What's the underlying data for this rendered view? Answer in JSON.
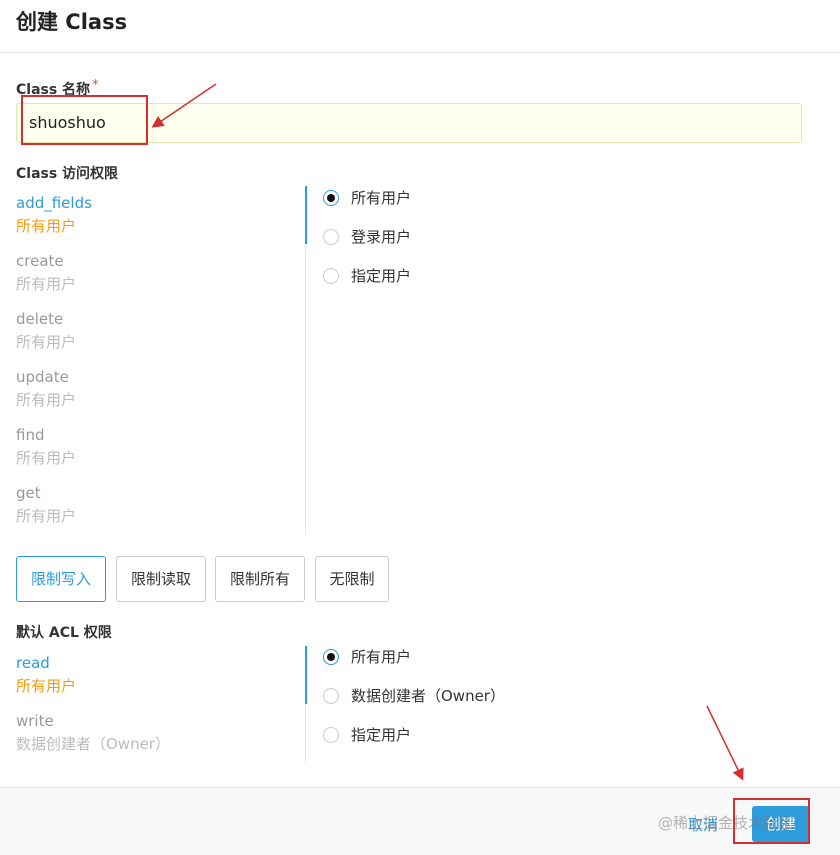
{
  "dialog": {
    "title": "创建 Class"
  },
  "class_name": {
    "label": "Class 名称",
    "required_mark": "*",
    "value": "shuoshuo"
  },
  "class_access": {
    "label": "Class 访问权限",
    "permissions": [
      {
        "name": "add_fields",
        "value": "所有用户"
      },
      {
        "name": "create",
        "value": "所有用户"
      },
      {
        "name": "delete",
        "value": "所有用户"
      },
      {
        "name": "update",
        "value": "所有用户"
      },
      {
        "name": "find",
        "value": "所有用户"
      },
      {
        "name": "get",
        "value": "所有用户"
      }
    ],
    "selected_permission": "add_fields",
    "options": [
      "所有用户",
      "登录用户",
      "指定用户"
    ],
    "selected_option": "所有用户"
  },
  "presets": {
    "buttons": [
      "限制写入",
      "限制读取",
      "限制所有",
      "无限制"
    ],
    "active": "限制写入"
  },
  "default_acl": {
    "label": "默认 ACL 权限",
    "permissions": [
      {
        "name": "read",
        "value": "所有用户"
      },
      {
        "name": "write",
        "value": "数据创建者（Owner）"
      }
    ],
    "selected_permission": "read",
    "options": [
      "所有用户",
      "数据创建者（Owner）",
      "指定用户"
    ],
    "selected_option": "所有用户"
  },
  "footer": {
    "cancel_label": "取消",
    "create_label": "创建"
  },
  "watermark": "@稀土掘金技术社区",
  "colors": {
    "accent": "#2d9cdb",
    "highlight": "#f39c12",
    "annotation": "#d32f2f",
    "input_bg": "#fffff0"
  }
}
